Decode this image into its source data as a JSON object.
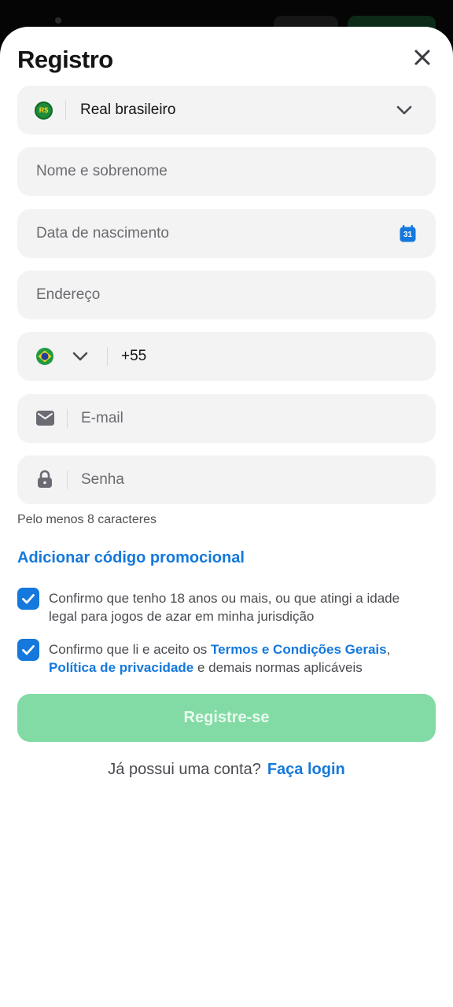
{
  "header": {
    "title": "Registro",
    "close_icon": "close-icon"
  },
  "form": {
    "currency": {
      "badge": "R$",
      "value": "Real brasileiro",
      "icon": "chevron-down-icon"
    },
    "name": {
      "placeholder": "Nome e sobrenome"
    },
    "birthdate": {
      "placeholder": "Data de nascimento",
      "calendar_day": "31",
      "icon": "calendar-icon"
    },
    "address": {
      "placeholder": "Endereço"
    },
    "phone": {
      "country_flag": "brazil-flag-icon",
      "dial_code": "+55"
    },
    "email": {
      "placeholder": "E-mail",
      "icon": "envelope-icon"
    },
    "password": {
      "placeholder": "Senha",
      "icon": "lock-icon",
      "hint": "Pelo menos 8 caracteres"
    }
  },
  "promo_link": "Adicionar código promocional",
  "consents": {
    "age": {
      "checked": true,
      "text": "Confirmo que tenho 18 anos ou mais, ou que atingi a idade legal para jogos de azar em minha jurisdição"
    },
    "terms": {
      "checked": true,
      "prefix": "Confirmo que li e aceito os ",
      "terms_link": "Termos e Condições Gerais",
      "comma": ",",
      "privacy_link": "Política de privacidade",
      "suffix": " e demais normas aplicáveis"
    }
  },
  "submit_label": "Registre-se",
  "login": {
    "question": "Já possui uma conta?",
    "link": "Faça login"
  },
  "colors": {
    "accent": "#1478dc",
    "submit_disabled": "#82dba4",
    "field_bg": "#f3f3f4"
  }
}
